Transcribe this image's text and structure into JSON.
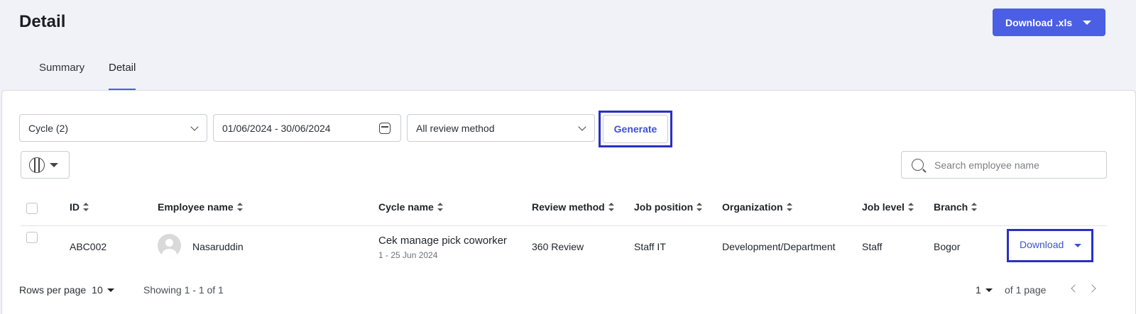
{
  "header": {
    "title": "Detail",
    "download_xls_label": "Download .xls"
  },
  "tabs": [
    {
      "label": "Summary",
      "active": false
    },
    {
      "label": "Detail",
      "active": true
    }
  ],
  "filters": {
    "cycle": "Cycle (2)",
    "date_range": "01/06/2024 - 30/06/2024",
    "review_method": "All review method",
    "generate_label": "Generate"
  },
  "search": {
    "placeholder": "Search employee name"
  },
  "table": {
    "columns": [
      "ID",
      "Employee name",
      "Cycle name",
      "Review method",
      "Job position",
      "Organization",
      "Job level",
      "Branch"
    ],
    "rows": [
      {
        "id": "ABC002",
        "employee_name": "Nasaruddin",
        "cycle_name": "Cek manage pick coworker",
        "cycle_dates": "1 - 25 Jun 2024",
        "review_method": "360 Review",
        "job_position": "Staff IT",
        "organization": "Development/Department",
        "job_level": "Staff",
        "branch": "Bogor",
        "action_label": "Download"
      }
    ]
  },
  "footer": {
    "rows_per_page_label": "Rows per page",
    "rows_per_page_value": "10",
    "showing": "Showing 1 - 1 of 1",
    "current_page": "1",
    "of_pages": "of 1 page"
  },
  "colors": {
    "accent": "#4a5fe4",
    "highlight_border": "#2a2fc4"
  }
}
